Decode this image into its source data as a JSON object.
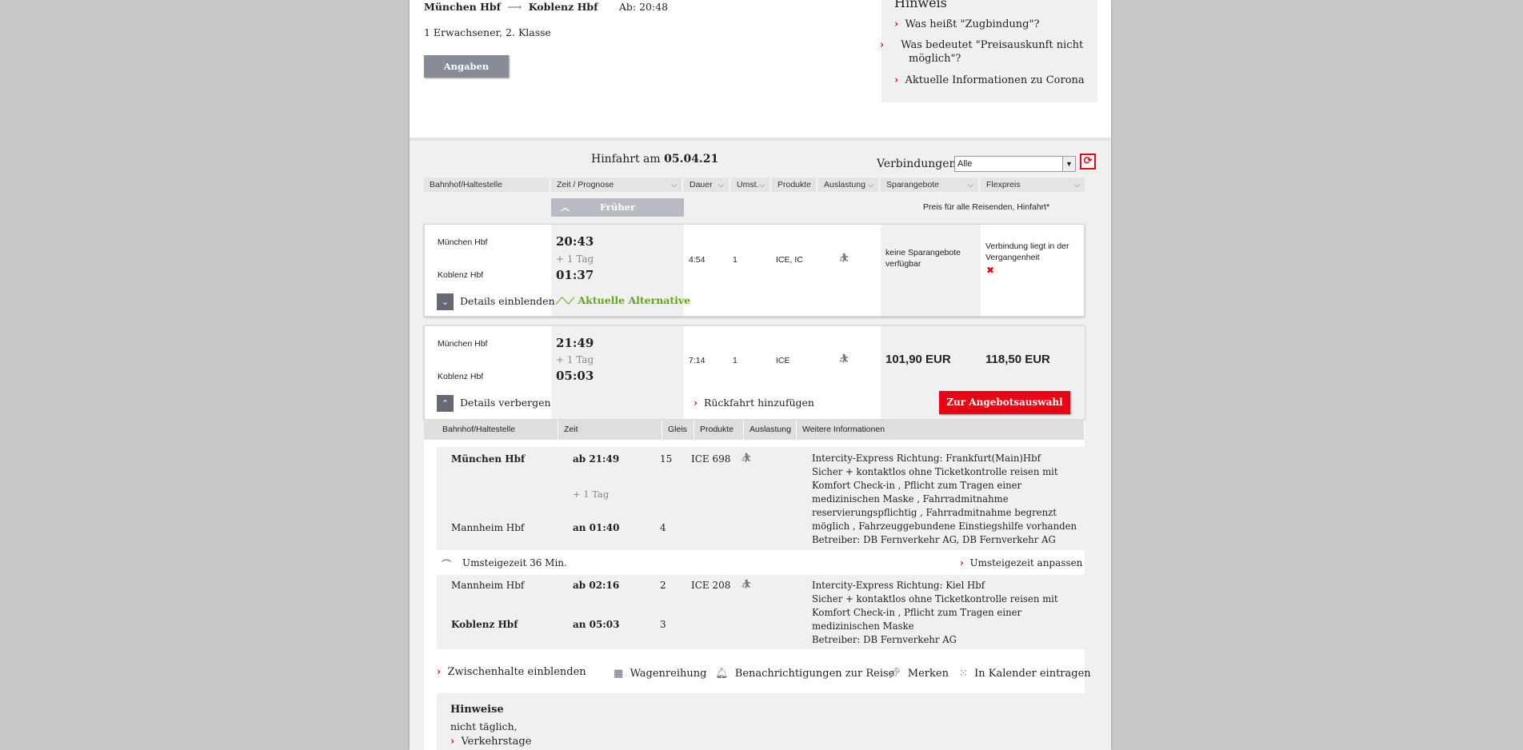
{
  "summary": {
    "from": "München Hbf",
    "to": "Koblenz Hbf",
    "departure": "Ab: 20:48",
    "travellers": "1 Erwachsener, 2. Klasse",
    "change_button": "Angaben ändern"
  },
  "hinweis": {
    "title": "Hinweis",
    "links": [
      "Was heißt \"Zugbindung\"?",
      "Was bedeutet \"Preisauskunft nicht möglich\"?",
      "Aktuelle Informationen zu Corona"
    ]
  },
  "outbound": {
    "label": "Hinfahrt am",
    "date": "05.04.21",
    "connections_label": "Verbindungen",
    "connections_value": "Alle"
  },
  "columns": [
    "Bahnhof/Haltestelle",
    "Zeit / Prognose",
    "Dauer",
    "Umst.",
    "Produkte",
    "Auslastung",
    "Sparangebote",
    "Flexpreis"
  ],
  "earlier_button": "Früher",
  "price_note": "Preis für alle Reisenden, Hinfahrt*",
  "connections": [
    {
      "from": "München Hbf",
      "to": "Koblenz Hbf",
      "dep": "20:43",
      "next_day": "+ 1 Tag",
      "arr": "01:37",
      "duration": "4:54",
      "changes": "1",
      "products": "ICE, IC",
      "saver": "keine Sparangebote verfügbar",
      "flex": "Verbindung liegt in der Vergangenheit",
      "toggle": "Details einblenden",
      "alternative": "Aktuelle Alternative"
    },
    {
      "from": "München Hbf",
      "to": "Koblenz Hbf",
      "dep": "21:49",
      "next_day": "+ 1 Tag",
      "arr": "05:03",
      "duration": "7:14",
      "changes": "1",
      "products": "ICE",
      "saver": "101,90 EUR",
      "flex": "118,50 EUR",
      "toggle": "Details verbergen",
      "return_link": "Rückfahrt hinzufügen",
      "offer_button": "Zur Angebotsauswahl"
    }
  ],
  "details": {
    "columns": [
      "Bahnhof/Haltestelle",
      "Zeit",
      "Gleis",
      "Produkte",
      "Auslastung",
      "Weitere Informationen"
    ],
    "seg1": {
      "from": "München Hbf",
      "dep": "ab 21:49",
      "dep_track": "15",
      "train": "ICE 698",
      "next_day": "+ 1 Tag",
      "to": "Mannheim Hbf",
      "arr": "an 01:40",
      "arr_track": "4",
      "info": [
        "Intercity-Express Richtung: Frankfurt(Main)Hbf",
        "Sicher + kontaktlos ohne Ticketkontrolle reisen mit",
        "Komfort Check-in , Pflicht zum Tragen einer",
        "medizinischen Maske , Fahrradmitnahme",
        "reservierungspflichtig , Fahrradmitnahme begrenzt",
        "möglich , Fahrzeuggebundene Einstiegshilfe vorhanden",
        "Betreiber: DB Fernverkehr AG, DB Fernverkehr AG"
      ]
    },
    "transfer": "Umsteigezeit 36 Min.",
    "transfer_link": "Umsteigezeit anpassen",
    "seg2": {
      "from": "Mannheim Hbf",
      "dep": "ab 02:16",
      "dep_track": "2",
      "train": "ICE 208",
      "to": "Koblenz Hbf",
      "arr": "an 05:03",
      "arr_track": "3",
      "info": [
        "Intercity-Express Richtung: Kiel Hbf",
        "Sicher + kontaktlos ohne Ticketkontrolle reisen mit",
        "Komfort Check-in , Pflicht zum Tragen einer",
        "medizinischen Maske",
        "Betreiber: DB Fernverkehr AG"
      ]
    },
    "actions": {
      "stops": "Zwischenhalte einblenden",
      "wagon": "Wagenreihung",
      "notify": "Benachrichtigungen zur Reise",
      "remember": "Merken",
      "calendar": "In Kalender eintragen"
    },
    "notes": {
      "title": "Hinweise",
      "text": "nicht täglich,",
      "link": "Verkehrstage"
    }
  },
  "colors": {
    "accent": "#ec0016",
    "green": "#63a615",
    "button_gray": "#878c96"
  }
}
